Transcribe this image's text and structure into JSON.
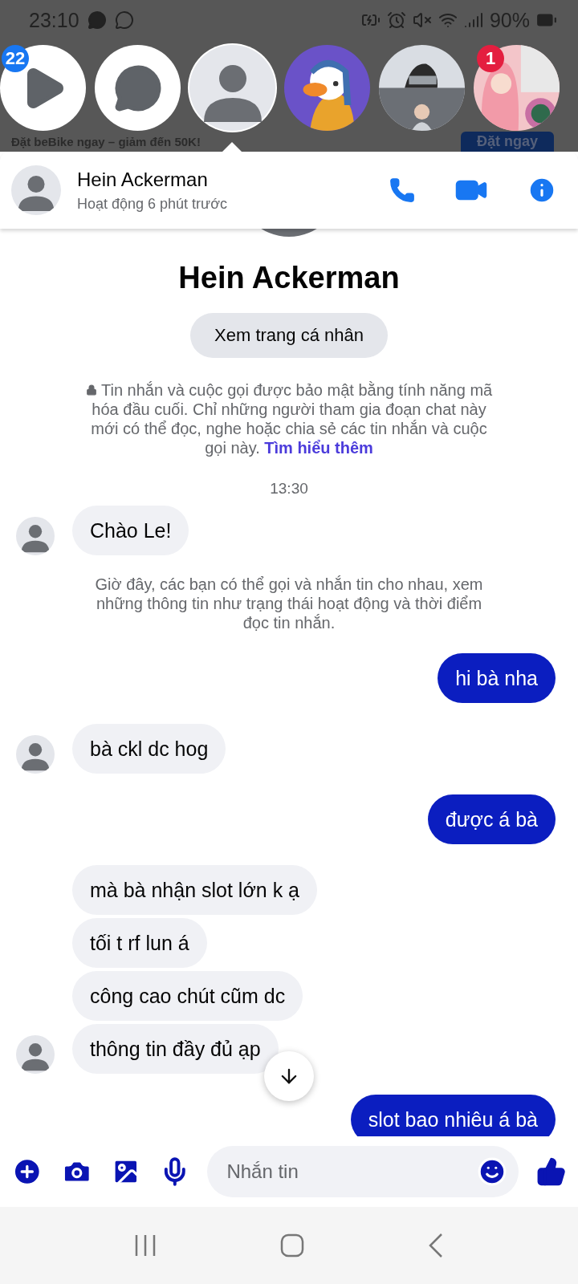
{
  "status_bar": {
    "time": "23:10",
    "battery": "90%"
  },
  "chat_heads": [
    {
      "kind": "play",
      "badge": "22",
      "color": "#1877f2",
      "selected": false
    },
    {
      "kind": "messenger",
      "selected": false
    },
    {
      "kind": "avatar",
      "selected": true
    },
    {
      "kind": "picture",
      "selected": false
    },
    {
      "kind": "picture",
      "selected": false
    },
    {
      "kind": "picture",
      "badge": "1",
      "color": "#e41e3f",
      "selected": false
    }
  ],
  "background_ad": {
    "headline": "Đặt beBike ngay – giảm đến 50K!",
    "button": "Đặt ngay"
  },
  "conversation_header": {
    "name": "Hein Ackerman",
    "status": "Hoạt động 6 phút trước"
  },
  "profile": {
    "name": "Hein Ackerman",
    "button": "Xem trang cá nhân"
  },
  "encryption_notice": {
    "text": "Tin nhắn và cuộc gọi được bảo mật bằng tính năng mã hóa đầu cuối. Chỉ những người tham gia đoạn chat này mới có thể đọc, nghe hoặc chia sẻ các tin nhắn và cuộc gọi này.",
    "link": "Tìm hiểu thêm"
  },
  "messages": [
    {
      "kind": "time",
      "text": "13:30"
    },
    {
      "kind": "incoming",
      "text": "Chào Le!",
      "avatar": true
    },
    {
      "kind": "system",
      "text": "Giờ đây, các bạn có thể gọi và nhắn tin cho nhau, xem những thông tin như trạng thái hoạt động và thời điểm đọc tin nhắn."
    },
    {
      "kind": "outgoing",
      "text": "hi bà nha"
    },
    {
      "kind": "incoming",
      "text": "bà ckl dc hog",
      "avatar": true
    },
    {
      "kind": "outgoing",
      "text": "được á bà"
    },
    {
      "kind": "incoming",
      "text": "mà bà nhận slot lớn k ạ",
      "avatar": false
    },
    {
      "kind": "incoming",
      "text": "tối t rf lun á",
      "avatar": false
    },
    {
      "kind": "incoming",
      "text": "công cao chút cũm dc",
      "avatar": false
    },
    {
      "kind": "incoming",
      "text": "thông tin đầy đủ ạp",
      "avatar": true
    },
    {
      "kind": "outgoing",
      "text": "slot bao nhiêu á bà"
    }
  ],
  "composer": {
    "placeholder": "Nhắn tin"
  }
}
